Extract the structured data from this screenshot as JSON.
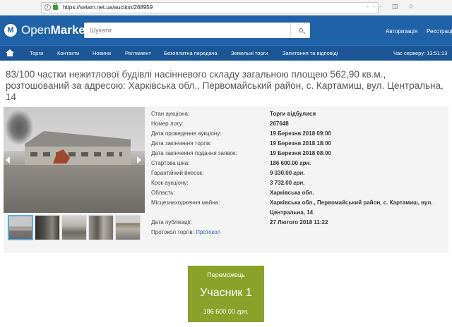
{
  "browser": {
    "url": "https://setam.net.ua/auction/268959"
  },
  "header": {
    "logo_open": "Open",
    "logo_market": "Market",
    "search_placeholder": "Шукати",
    "auth": "Авторизація",
    "register": "Реєстрація"
  },
  "nav": {
    "items": [
      "Торги",
      "Контакти",
      "Новини",
      "Регламент",
      "Безоплатна передача",
      "Земельні торги",
      "Запитання та відповіді"
    ],
    "server_time": "Час серверу: 13:51:13"
  },
  "lot": {
    "title": "83/100 частки нежитлової будівлі насінневого складу загальною площею 562,90 кв.м., розтошований за адресою: Харківська обл., Первомайський район, с. Картамиш, вул. Центральна, 14",
    "properties": [
      {
        "label": "Стан аукціона:",
        "value": "Торги відбулися"
      },
      {
        "label": "Номер лоту:",
        "value": "267648"
      },
      {
        "label": "Дата проведення аукціону:",
        "value": "19 Березня 2018 09:00"
      },
      {
        "label": "Дата закінчення торгів:",
        "value": "19 Березня 2018 18:00"
      },
      {
        "label": "Дата закінчення подання заявок:",
        "value": "19 Березня 2018 08:00"
      },
      {
        "label": "Стартова ціна:",
        "value": "186 600.00",
        "unit": "грн."
      },
      {
        "label": "Гарантійний внесок:",
        "value": "9 330.00",
        "unit": "грн."
      },
      {
        "label": "Крок аукціону:",
        "value": "3 732.00",
        "unit": "грн."
      },
      {
        "label": "Область:",
        "value": "Харківська обл."
      },
      {
        "label": "Місцезнаходження майна:",
        "value_line1": "Харківська обл., Первомайський район, с. Картамиш, вул.",
        "value_line2": "Центральна, 14"
      },
      {
        "label": "Дата публікації:",
        "value": "27 Лютого 2018 11:22"
      }
    ],
    "protocol_label": "Протокол торгів:",
    "protocol_link": "Протокол"
  },
  "winner": {
    "label": "Переможець",
    "name": "Учасник 1",
    "price": "186 600.00",
    "unit": "грн."
  },
  "colors": {
    "header": "#1f62a8",
    "nav": "#1b5696",
    "winner": "#8aa22a"
  }
}
